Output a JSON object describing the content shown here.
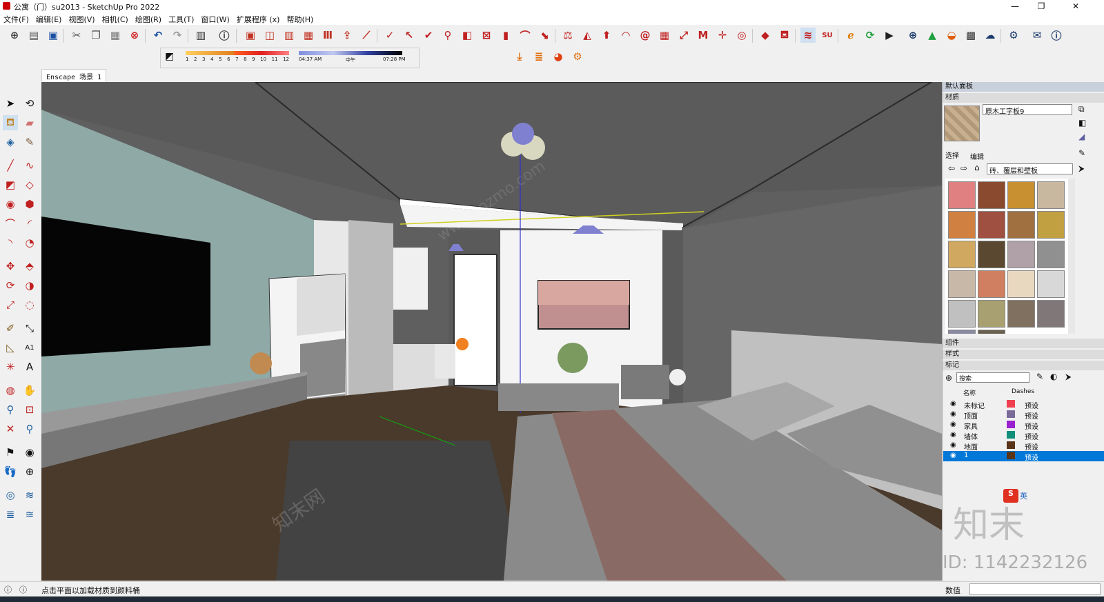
{
  "window": {
    "title": "公寓（门）su2013 - SketchUp Pro 2022",
    "minimize": "—",
    "maximize": "❐",
    "close": "✕"
  },
  "menu": [
    "文件(F)",
    "编辑(E)",
    "视图(V)",
    "相机(C)",
    "绘图(R)",
    "工具(T)",
    "窗口(W)",
    "扩展程序 (x)",
    "帮助(H)"
  ],
  "shadow": {
    "months": [
      "1",
      "2",
      "3",
      "4",
      "5",
      "6",
      "7",
      "8",
      "9",
      "10",
      "11",
      "12"
    ],
    "time_start": "04:37 AM",
    "time_mid": "中午",
    "time_end": "07:28 PM"
  },
  "scene_tab": "Enscape 场景 1",
  "status": {
    "hint": "点击平面以加载材质到颜料桶",
    "value_label": "数值"
  },
  "panel": {
    "title": "默认面板",
    "materials_title": "材质",
    "material_name": "原木工字板9",
    "tab_select": "选择",
    "tab_edit": "编辑",
    "category": "砖、覆层和壁板",
    "components_title": "组件",
    "styles_title": "样式",
    "tags_title": "标记",
    "search_placeholder": "搜索",
    "col_name": "名称",
    "col_dashes": "Dashes",
    "tags": [
      {
        "name": "未标记",
        "color": "#f04050",
        "dashes": "预设"
      },
      {
        "name": "顶面",
        "color": "#7a6a9a",
        "dashes": "预设"
      },
      {
        "name": "家具",
        "color": "#9a20d0",
        "dashes": "预设"
      },
      {
        "name": "墙体",
        "color": "#10907a",
        "dashes": "预设"
      },
      {
        "name": "地面",
        "color": "#5a3418",
        "dashes": "预设"
      },
      {
        "name": "1",
        "color": "#5a3418",
        "dashes": "预设",
        "selected": true
      }
    ],
    "swatches": [
      "#e08080",
      "#8a4a30",
      "#c89030",
      "#c8b8a0",
      "#d08040",
      "#a05040",
      "#a07040",
      "#c0a040",
      "#d0a860",
      "#5a4830",
      "#b0a0a8",
      "#909090",
      "#c8b8a8",
      "#d08060",
      "#e8d8c0",
      "#d8d8d8",
      "#c0c0c0",
      "#a8a070",
      "#807060",
      "#807878",
      "#8a8aa0",
      "#6a6050"
    ]
  },
  "watermark": {
    "brand": "知末",
    "id": "ID: 1142232126",
    "site": "www.znzmo.com",
    "site_cn": "知末网"
  },
  "ime": {
    "logo": "S",
    "lang": "英"
  },
  "colors": {
    "accent": "#0078d7",
    "wall_teal": "#8fa9a6",
    "floor": "#4a3a2c",
    "ceiling": "#585858"
  }
}
